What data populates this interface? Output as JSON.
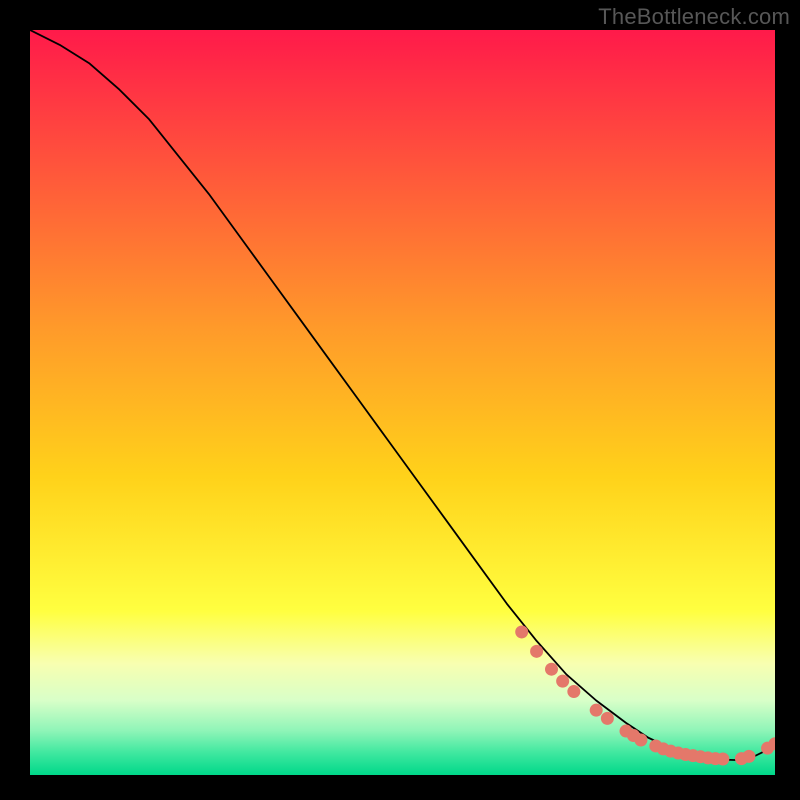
{
  "watermark": "TheBottleneck.com",
  "chart_data": {
    "type": "line",
    "title": "",
    "xlabel": "",
    "ylabel": "",
    "xlim": [
      0,
      100
    ],
    "ylim": [
      0,
      100
    ],
    "background_gradient": [
      {
        "pos": 0.0,
        "color": "#ff1a4a"
      },
      {
        "pos": 0.4,
        "color": "#ff9a2a"
      },
      {
        "pos": 0.6,
        "color": "#ffd21a"
      },
      {
        "pos": 0.78,
        "color": "#ffff40"
      },
      {
        "pos": 0.85,
        "color": "#f8ffb0"
      },
      {
        "pos": 0.9,
        "color": "#d8ffc8"
      },
      {
        "pos": 0.94,
        "color": "#90f5b8"
      },
      {
        "pos": 0.97,
        "color": "#40e8a0"
      },
      {
        "pos": 1.0,
        "color": "#00d88a"
      }
    ],
    "series": [
      {
        "name": "curve",
        "color": "#000000",
        "width": 1.8,
        "x": [
          0,
          4,
          8,
          12,
          16,
          20,
          24,
          28,
          32,
          36,
          40,
          44,
          48,
          52,
          56,
          60,
          64,
          68,
          72,
          76,
          80,
          83,
          86,
          89,
          92,
          95,
          97,
          99,
          100
        ],
        "y": [
          100,
          98,
          95.5,
          92,
          88,
          83,
          78,
          72.5,
          67,
          61.5,
          56,
          50.5,
          45,
          39.5,
          34,
          28.5,
          23,
          18,
          13.5,
          10,
          7,
          5,
          3.6,
          2.6,
          2.1,
          2.0,
          2.4,
          3.4,
          4.2
        ]
      }
    ],
    "markers": [
      {
        "x": 66,
        "y": 19.2,
        "r": 6.5,
        "color": "#e4786a"
      },
      {
        "x": 68,
        "y": 16.6,
        "r": 6.5,
        "color": "#e4786a"
      },
      {
        "x": 70,
        "y": 14.2,
        "r": 6.5,
        "color": "#e4786a"
      },
      {
        "x": 71.5,
        "y": 12.6,
        "r": 6.5,
        "color": "#e4786a"
      },
      {
        "x": 73,
        "y": 11.2,
        "r": 6.5,
        "color": "#e4786a"
      },
      {
        "x": 76,
        "y": 8.7,
        "r": 6.5,
        "color": "#e4786a"
      },
      {
        "x": 77.5,
        "y": 7.6,
        "r": 6.5,
        "color": "#e4786a"
      },
      {
        "x": 80,
        "y": 5.9,
        "r": 6.5,
        "color": "#e4786a"
      },
      {
        "x": 81,
        "y": 5.3,
        "r": 6.5,
        "color": "#e4786a"
      },
      {
        "x": 82,
        "y": 4.7,
        "r": 6.5,
        "color": "#e4786a"
      },
      {
        "x": 84,
        "y": 3.9,
        "r": 6.5,
        "color": "#e4786a"
      },
      {
        "x": 85,
        "y": 3.5,
        "r": 6.5,
        "color": "#e4786a"
      },
      {
        "x": 86,
        "y": 3.2,
        "r": 6.5,
        "color": "#e4786a"
      },
      {
        "x": 87,
        "y": 2.95,
        "r": 6.5,
        "color": "#e4786a"
      },
      {
        "x": 88,
        "y": 2.75,
        "r": 6.5,
        "color": "#e4786a"
      },
      {
        "x": 89,
        "y": 2.6,
        "r": 6.5,
        "color": "#e4786a"
      },
      {
        "x": 90,
        "y": 2.45,
        "r": 6.5,
        "color": "#e4786a"
      },
      {
        "x": 91,
        "y": 2.3,
        "r": 6.5,
        "color": "#e4786a"
      },
      {
        "x": 92,
        "y": 2.2,
        "r": 6.5,
        "color": "#e4786a"
      },
      {
        "x": 93,
        "y": 2.15,
        "r": 6.5,
        "color": "#e4786a"
      },
      {
        "x": 95.5,
        "y": 2.2,
        "r": 6.5,
        "color": "#e4786a"
      },
      {
        "x": 96.5,
        "y": 2.5,
        "r": 6.5,
        "color": "#e4786a"
      },
      {
        "x": 99,
        "y": 3.6,
        "r": 6.5,
        "color": "#e4786a"
      },
      {
        "x": 100,
        "y": 4.2,
        "r": 6.5,
        "color": "#e4786a"
      }
    ]
  }
}
